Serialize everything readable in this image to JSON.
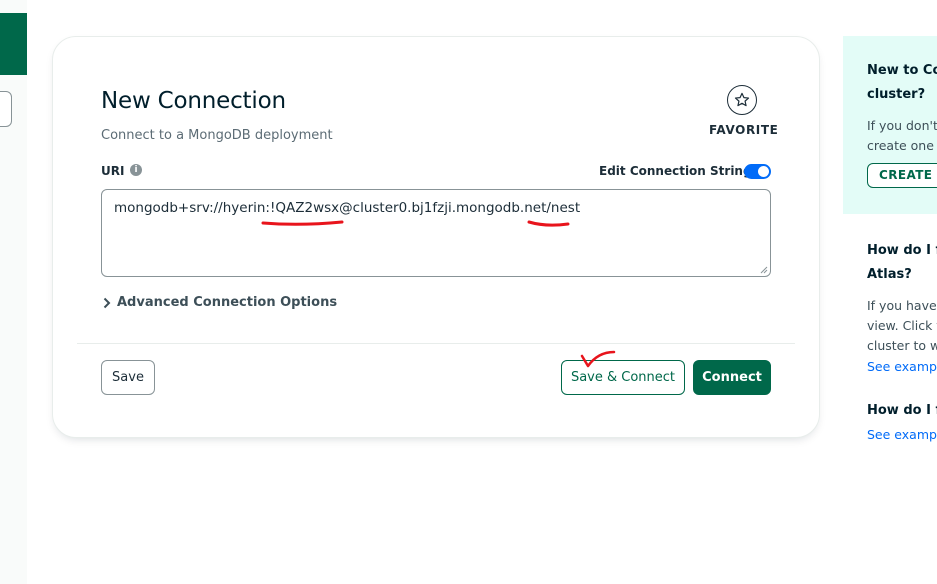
{
  "form": {
    "title": "New Connection",
    "subtitle": "Connect to a MongoDB deployment",
    "favorite_label": "FAVORITE",
    "uri_label": "URI",
    "edit_connection_label": "Edit Connection String",
    "edit_connection_enabled": true,
    "uri_value": "mongodb+srv://hyerin:!QAZ2wsx@cluster0.bj1fzji.mongodb.net/nest",
    "advanced_label": "Advanced Connection Options",
    "save_label": "Save",
    "save_connect_label": "Save & Connect",
    "connect_label": "Connect"
  },
  "side": {
    "new_cluster_heading_1": "New to Co",
    "new_cluster_heading_2": "cluster?",
    "new_cluster_text_1": "If you don't",
    "new_cluster_text_2": "create one",
    "create_button": "CREATE F",
    "find_heading_1": "How do I fi",
    "find_heading_2": "Atlas?",
    "find_text_1": "If you have",
    "find_text_2": "view. Click t",
    "find_text_3": "cluster to w",
    "find_link": "See exampl",
    "format_heading": "How do I fo",
    "format_link": "See exampl"
  },
  "colors": {
    "brand_green": "#00684a",
    "toggle_blue": "#016bf8",
    "side_panel_bg": "#e3fcf7",
    "annotation_red": "#e8141c"
  },
  "icons": {
    "favorite": "star-icon",
    "info": "info-icon",
    "advanced": "chevron-right-icon"
  }
}
